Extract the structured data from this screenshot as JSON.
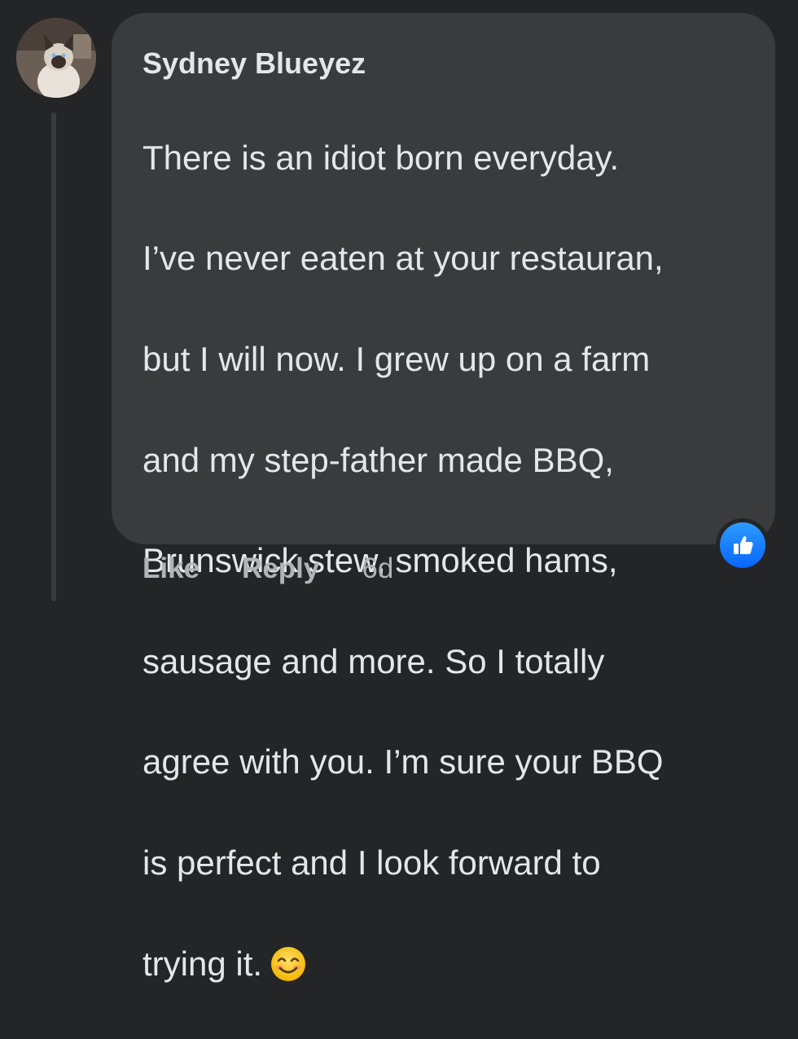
{
  "comment": {
    "author": "Sydney Blueyez",
    "lines": [
      "There is an idiot born everyday.",
      "I’ve never eaten at your restauran,",
      "but I will now. I grew up on a farm",
      "and my step-father made BBQ,",
      "Brunswick stew, smoked hams,",
      "sausage and more. So I totally",
      "agree with you. I’m sure your BBQ",
      "is perfect and I look forward to",
      "trying it."
    ],
    "emoji": "smiling-face-emoji",
    "reaction": "like-icon"
  },
  "actions": {
    "like_label": "Like",
    "reply_label": "Reply",
    "timestamp": "6d"
  },
  "colors": {
    "background": "#242526",
    "bubble": "#3a3b3c",
    "text": "#e4e6eb",
    "muted": "#b0b3b8",
    "like_blue": "#0866ff"
  }
}
